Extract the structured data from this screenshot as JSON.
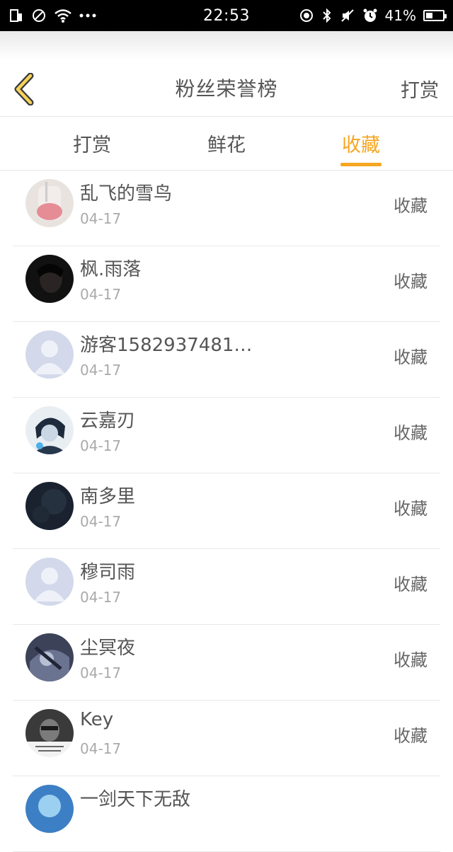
{
  "status_bar": {
    "time": "22:53",
    "battery": "41%",
    "battery_level": 0.41,
    "left_icons": [
      "sim-icon",
      "do-not-disturb-icon",
      "wifi-icon",
      "more-dots-icon"
    ],
    "right_icons": [
      "location-icon",
      "bluetooth-icon",
      "mute-icon",
      "alarm-icon",
      "battery-icon"
    ]
  },
  "header": {
    "title": "粉丝荣誉榜",
    "action": "打赏",
    "back_icon": "chevron-left-icon",
    "accent_color": "#f5a623"
  },
  "tabs": [
    {
      "label": "打赏",
      "active": false
    },
    {
      "label": "鲜花",
      "active": false
    },
    {
      "label": "收藏",
      "active": true
    }
  ],
  "fans": [
    {
      "name": "乱飞的雪鸟",
      "date": "04-17",
      "action": "收藏",
      "avatar": "avatar-pink-jar"
    },
    {
      "name": "枫.雨落",
      "date": "04-17",
      "action": "收藏",
      "avatar": "avatar-dark"
    },
    {
      "name": "游客1582937481…",
      "date": "04-17",
      "action": "收藏",
      "avatar": "avatar-default"
    },
    {
      "name": "云嘉刃",
      "date": "04-17",
      "action": "收藏",
      "avatar": "avatar-anime"
    },
    {
      "name": "南多里",
      "date": "04-17",
      "action": "收藏",
      "avatar": "avatar-night"
    },
    {
      "name": "穆司雨",
      "date": "04-17",
      "action": "收藏",
      "avatar": "avatar-default"
    },
    {
      "name": "尘冥夜",
      "date": "04-17",
      "action": "收藏",
      "avatar": "avatar-dark-anime"
    },
    {
      "name": "Key",
      "date": "04-17",
      "action": "收藏",
      "avatar": "avatar-portrait"
    },
    {
      "name": "一剑天下无敌",
      "date": "",
      "action": "",
      "avatar": "avatar-blue"
    }
  ]
}
